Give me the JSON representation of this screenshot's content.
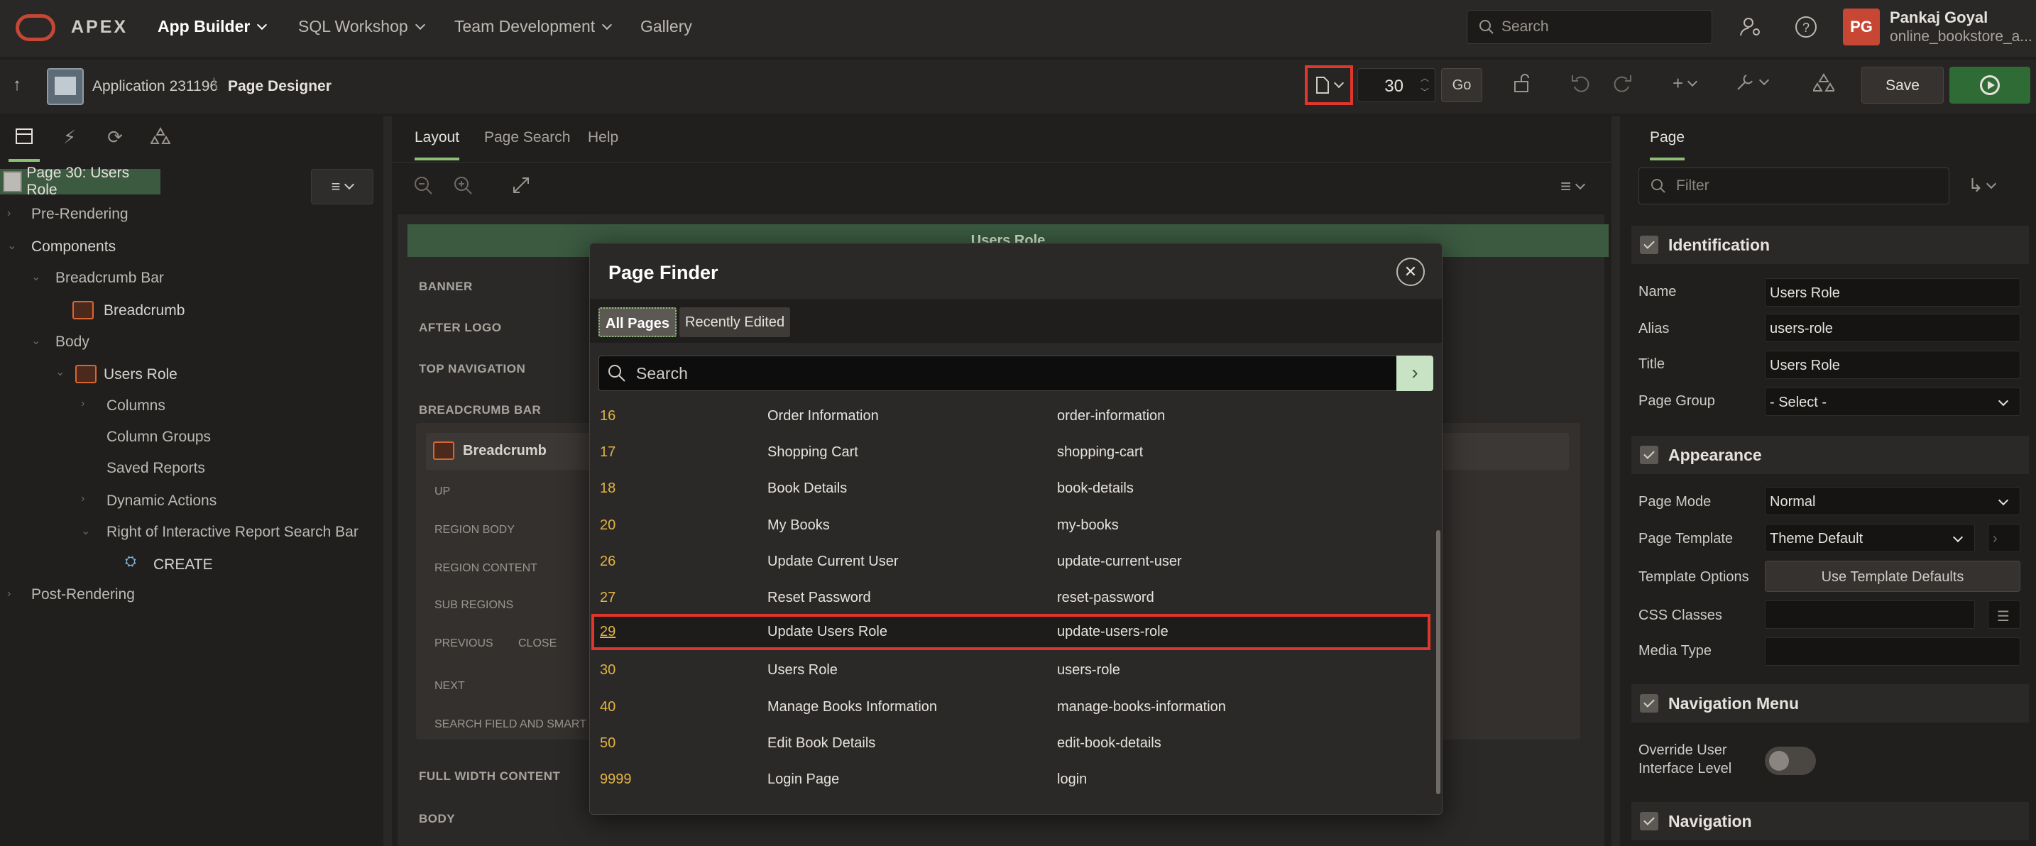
{
  "topnav": {
    "brand": "APEX",
    "menus": [
      "App Builder",
      "SQL Workshop",
      "Team Development",
      "Gallery"
    ],
    "search_placeholder": "Search",
    "avatar_initials": "PG",
    "user_name": "Pankaj Goyal",
    "user_workspace": "online_bookstore_a..."
  },
  "toolbar": {
    "application": "Application 231196",
    "separator": "\\",
    "page_designer": "Page Designer",
    "page_number": "30",
    "go_label": "Go",
    "save_label": "Save"
  },
  "left": {
    "root": "Page 30: Users Role",
    "tree": [
      "Pre-Rendering",
      "Components",
      "Breadcrumb Bar",
      "Breadcrumb",
      "Body",
      "Users Role",
      "Columns",
      "Column Groups",
      "Saved Reports",
      "Dynamic Actions",
      "Right of Interactive Report Search Bar",
      "CREATE",
      "Post-Rendering"
    ]
  },
  "center": {
    "tabs": [
      "Layout",
      "Page Search",
      "Help"
    ],
    "title_bar": "Users Role",
    "slots": [
      "BANNER",
      "AFTER LOGO",
      "TOP NAVIGATION",
      "BREADCRUMB BAR",
      "FULL WIDTH CONTENT",
      "BODY"
    ],
    "breadcrumb_region": "Breadcrumb",
    "sub_slots": [
      "UP",
      "REGION BODY",
      "REGION CONTENT",
      "SUB REGIONS",
      "PREVIOUS",
      "CLOSE",
      "NEXT",
      "SEARCH FIELD AND SMART FI"
    ]
  },
  "right": {
    "tab": "Page",
    "filter_placeholder": "Filter",
    "sections": [
      "Identification",
      "Appearance",
      "Navigation Menu",
      "Navigation"
    ],
    "identification": {
      "name_label": "Name",
      "name_value": "Users Role",
      "alias_label": "Alias",
      "alias_value": "users-role",
      "title_label": "Title",
      "title_value": "Users Role",
      "group_label": "Page Group",
      "group_value": "- Select -"
    },
    "appearance": {
      "mode_label": "Page Mode",
      "mode_value": "Normal",
      "template_label": "Page Template",
      "template_value": "Theme Default",
      "options_label": "Template Options",
      "options_button": "Use Template Defaults",
      "css_label": "CSS Classes",
      "media_label": "Media Type"
    },
    "navmenu": {
      "override_label_1": "Override User",
      "override_label_2": "Interface Level"
    }
  },
  "dialog": {
    "title": "Page Finder",
    "tabs": [
      "All Pages",
      "Recently Edited"
    ],
    "search_placeholder": "Search",
    "rows": [
      {
        "id": "16",
        "name": "Order Information",
        "alias": "order-information"
      },
      {
        "id": "17",
        "name": "Shopping Cart",
        "alias": "shopping-cart"
      },
      {
        "id": "18",
        "name": "Book Details",
        "alias": "book-details"
      },
      {
        "id": "20",
        "name": "My Books",
        "alias": "my-books"
      },
      {
        "id": "26",
        "name": "Update Current User",
        "alias": "update-current-user"
      },
      {
        "id": "27",
        "name": "Reset Password",
        "alias": "reset-password"
      },
      {
        "id": "29",
        "name": "Update Users Role",
        "alias": "update-users-role"
      },
      {
        "id": "30",
        "name": "Users Role",
        "alias": "users-role"
      },
      {
        "id": "40",
        "name": "Manage Books Information",
        "alias": "manage-books-information"
      },
      {
        "id": "50",
        "name": "Edit Book Details",
        "alias": "edit-book-details"
      },
      {
        "id": "9999",
        "name": "Login Page",
        "alias": "login"
      }
    ],
    "highlighted_id": "29"
  },
  "colors": {
    "accent_green": "#8cbf76",
    "highlight_red": "#e0362b",
    "page_id_yellow": "#e3b341",
    "brand_red": "#c74634"
  }
}
